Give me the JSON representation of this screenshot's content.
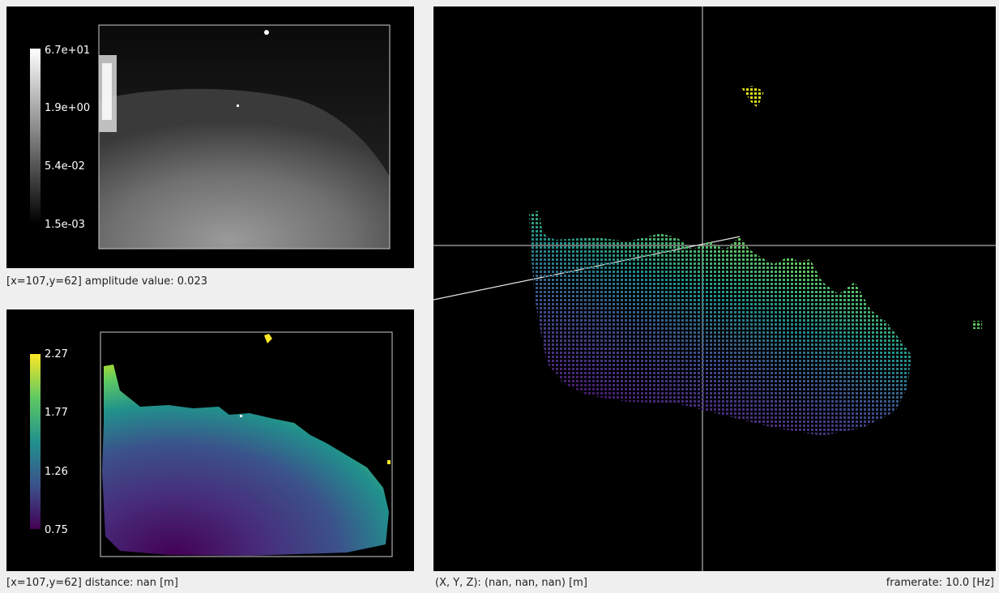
{
  "amplitude_view": {
    "colorbar_ticks": [
      "6.7e+01",
      "1.9e+00",
      "5.4e-02",
      "1.5e-03"
    ],
    "colormap": "gray",
    "status": "[x=107,y=62] amplitude value: 0.023"
  },
  "distance_view": {
    "colorbar_ticks": [
      "2.27",
      "1.77",
      "1.26",
      "0.75"
    ],
    "colormap": "viridis",
    "status": "[x=107,y=62] distance: nan [m]"
  },
  "pointcloud_view": {
    "coords_status": "(X, Y, Z): (nan, nan, nan) [m]",
    "framerate_status": "framerate: 10.0 [Hz]"
  },
  "colors": {
    "background": "#efefef",
    "panel": "#000000",
    "viridis_low": "#440154",
    "viridis_mid": "#21918c",
    "viridis_high": "#fde725"
  }
}
